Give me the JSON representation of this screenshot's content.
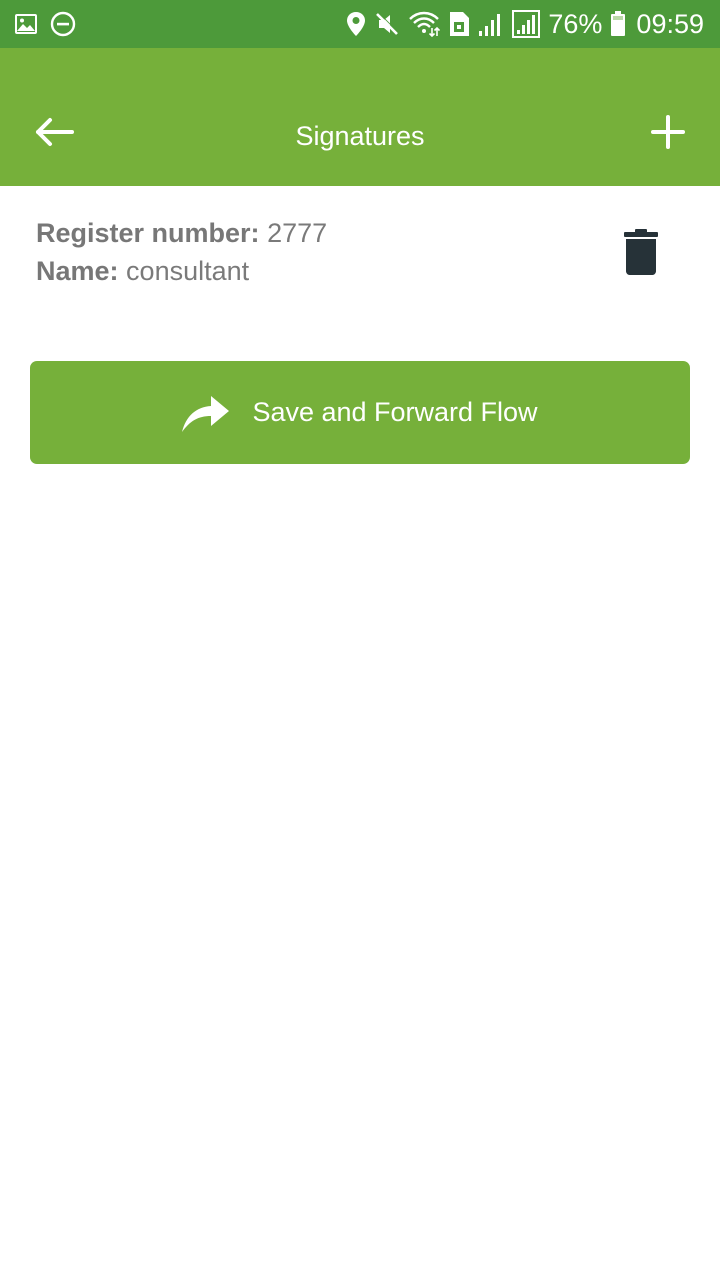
{
  "status_bar": {
    "battery_percent": "76%",
    "time": "09:59",
    "left_icons": [
      "image-icon",
      "do-not-disturb-icon"
    ],
    "right_icons": [
      "location-icon",
      "mute-icon",
      "wifi-icon",
      "sim-icon",
      "signal-icon",
      "signal-icon",
      "battery-icon"
    ]
  },
  "app_bar": {
    "title": "Signatures",
    "back_icon": "arrow-left-icon",
    "add_icon": "plus-icon"
  },
  "signature": {
    "register_label": "Register number:",
    "register_value": "2777",
    "name_label": "Name:",
    "name_value": "consultant",
    "delete_icon": "trash-icon"
  },
  "actions": {
    "save_forward_label": "Save and Forward Flow",
    "save_forward_icon": "share-forward-icon"
  },
  "colors": {
    "status_bar": "#4d9a3a",
    "primary": "#76b03a",
    "text_gray": "#7a7a7a",
    "trash": "#263238",
    "white": "#ffffff"
  }
}
